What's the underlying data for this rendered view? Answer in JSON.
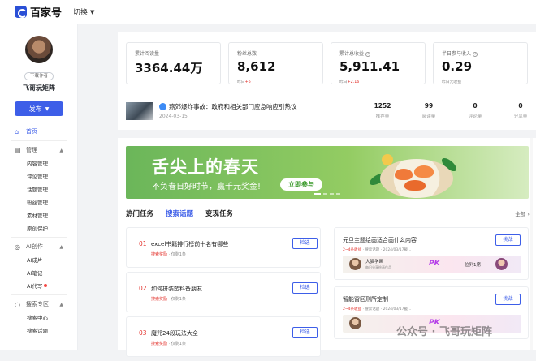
{
  "topbar": {
    "brand": "百家号",
    "switch_label": "切换"
  },
  "sidebar": {
    "author_tag": "下载作者",
    "username": "飞哥玩矩阵",
    "publish_label": "发布",
    "home": "首页",
    "manage": {
      "label": "管理",
      "items": [
        "内容管理",
        "评论管理",
        "话题管理",
        "粉丝管理",
        "素材管理",
        "原创保护"
      ]
    },
    "ai": {
      "label": "AI创作",
      "items": [
        "AI成片",
        "AI笔记",
        "AI代写"
      ]
    },
    "search": {
      "label": "搜索专区",
      "items": [
        "搜索中心",
        "搜索话题"
      ]
    }
  },
  "stats": [
    {
      "label": "累计阅读量",
      "value": "3364.44万",
      "sub": "",
      "delta": ""
    },
    {
      "label": "粉丝总数",
      "value": "8,612",
      "sub": "昨日",
      "delta": "+6"
    },
    {
      "label": "累计总收益",
      "value": "5,911.41",
      "sub": "昨日",
      "delta": "+2.16"
    },
    {
      "label": "半日参与收入",
      "value": "0.29",
      "sub": "昨日元收益",
      "delta": ""
    }
  ],
  "news": {
    "title": "燕郊爆炸事故：政府和相关部门应急响应引热议",
    "date": "2024-03-15",
    "stats": [
      {
        "value": "1252",
        "label": "推荐量"
      },
      {
        "value": "99",
        "label": "阅读量"
      },
      {
        "value": "0",
        "label": "评论量"
      },
      {
        "value": "0",
        "label": "分享量"
      }
    ]
  },
  "banner": {
    "title": "舌尖上的春天",
    "subtitle": "不负春日好时节，赢千元奖金!",
    "button": "立即参与"
  },
  "tabs": [
    "热门任务",
    "搜索话题",
    "变现任务"
  ],
  "tab_all": "全部 ›",
  "tasks": [
    {
      "num": "01",
      "title": "excel书籍排行榜前十名有哪些",
      "tag": "搜索奖励",
      "meta": "· 仅剩1条",
      "button": "检选"
    },
    {
      "num": "02",
      "title": "如何拼装塑料备朋友",
      "tag": "搜索奖励",
      "meta": "· 仅剩1条",
      "button": "检选"
    },
    {
      "num": "03",
      "title": "魔咒24段玩法大全",
      "tag": "搜索奖励",
      "meta": "· 仅剩1条",
      "button": "检选"
    }
  ],
  "topics": [
    {
      "title": "元旦主题绘画适合画什么内容",
      "tag": "2~4条收益",
      "meta": "· 搜索话题 · 2024/03/17截...",
      "button": "挑战",
      "who": "大猫学画",
      "desc": "每日分享绘画作品",
      "vs": "PK",
      "rank": "位列1席"
    },
    {
      "title": "智能窗区刑所定制",
      "tag": "2~4条收益",
      "meta": "· 搜索话题 · 2024/03/17截...",
      "button": "挑战",
      "who": "",
      "desc": "",
      "vs": "PK",
      "rank": ""
    }
  ],
  "watermark": "公众号 · 飞哥玩矩阵"
}
